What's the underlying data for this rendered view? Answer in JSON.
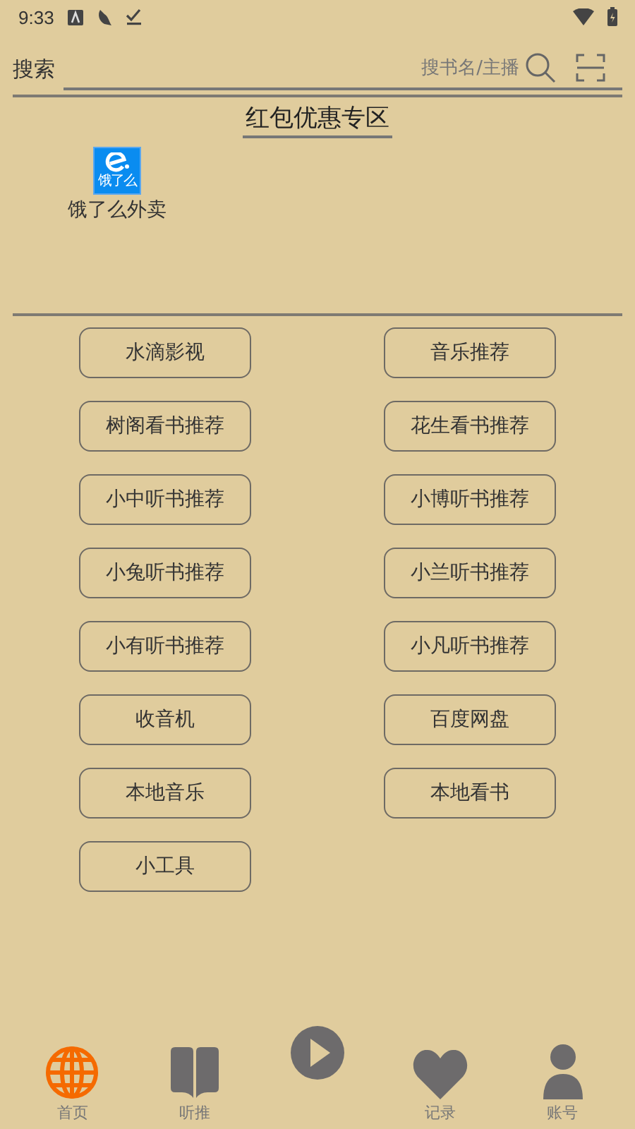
{
  "status_bar": {
    "time": "9:33"
  },
  "search": {
    "label": "搜索",
    "placeholder": "搜书名/主播"
  },
  "promo": {
    "title": "红包优惠专区",
    "apps": [
      {
        "icon_text": "饿了么",
        "label": "饿了么外卖"
      }
    ]
  },
  "buttons": [
    {
      "label": "水滴影视"
    },
    {
      "label": "音乐推荐"
    },
    {
      "label": "树阁看书推荐"
    },
    {
      "label": "花生看书推荐"
    },
    {
      "label": "小中听书推荐"
    },
    {
      "label": "小博听书推荐"
    },
    {
      "label": "小兔听书推荐"
    },
    {
      "label": "小兰听书推荐"
    },
    {
      "label": "小有听书推荐"
    },
    {
      "label": "小凡听书推荐"
    },
    {
      "label": "收音机"
    },
    {
      "label": "百度网盘"
    },
    {
      "label": "本地音乐"
    },
    {
      "label": "本地看书"
    },
    {
      "label": "小工具"
    }
  ],
  "nav": [
    {
      "kind": "globe",
      "label": "首页",
      "selected": true
    },
    {
      "kind": "book",
      "label": "听推",
      "selected": false
    },
    {
      "kind": "play",
      "selected": false
    },
    {
      "kind": "heart",
      "label": "记录",
      "selected": false
    },
    {
      "kind": "person",
      "label": "账号",
      "selected": false
    }
  ]
}
